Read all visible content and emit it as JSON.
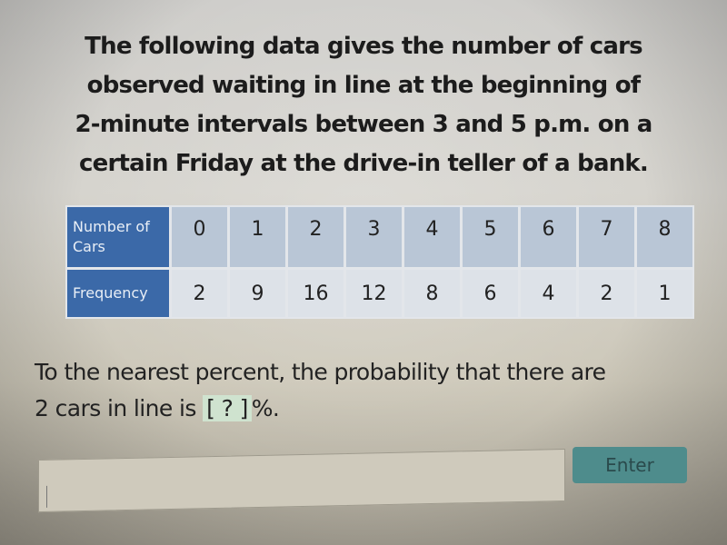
{
  "intro": {
    "lines": [
      "The following data gives the number of cars",
      "observed waiting in line at the beginning of",
      "2-minute intervals between 3 and 5 p.m. on a",
      "certain Friday at the drive-in teller of a bank."
    ]
  },
  "table": {
    "row_headers": [
      "Number of Cars",
      "Frequency"
    ],
    "number_of_cars": [
      "0",
      "1",
      "2",
      "3",
      "4",
      "5",
      "6",
      "7",
      "8"
    ],
    "frequency": [
      "2",
      "9",
      "16",
      "12",
      "8",
      "6",
      "4",
      "2",
      "1"
    ]
  },
  "question": {
    "line1": "To the nearest percent, the probability that there are",
    "line2_prefix": "2 cars in line is ",
    "blank": "[ ? ]",
    "line2_suffix": "%."
  },
  "answer": {
    "value": "",
    "placeholder": ""
  },
  "enter_button": {
    "label": "Enter"
  },
  "colors": {
    "header_blue": "#3b69a8",
    "number_cell": "#b9c6d6",
    "frequency_cell": "#dde2e8",
    "enter_teal": "#4e8c8c",
    "blank_highlight": "#cfe3cf"
  }
}
